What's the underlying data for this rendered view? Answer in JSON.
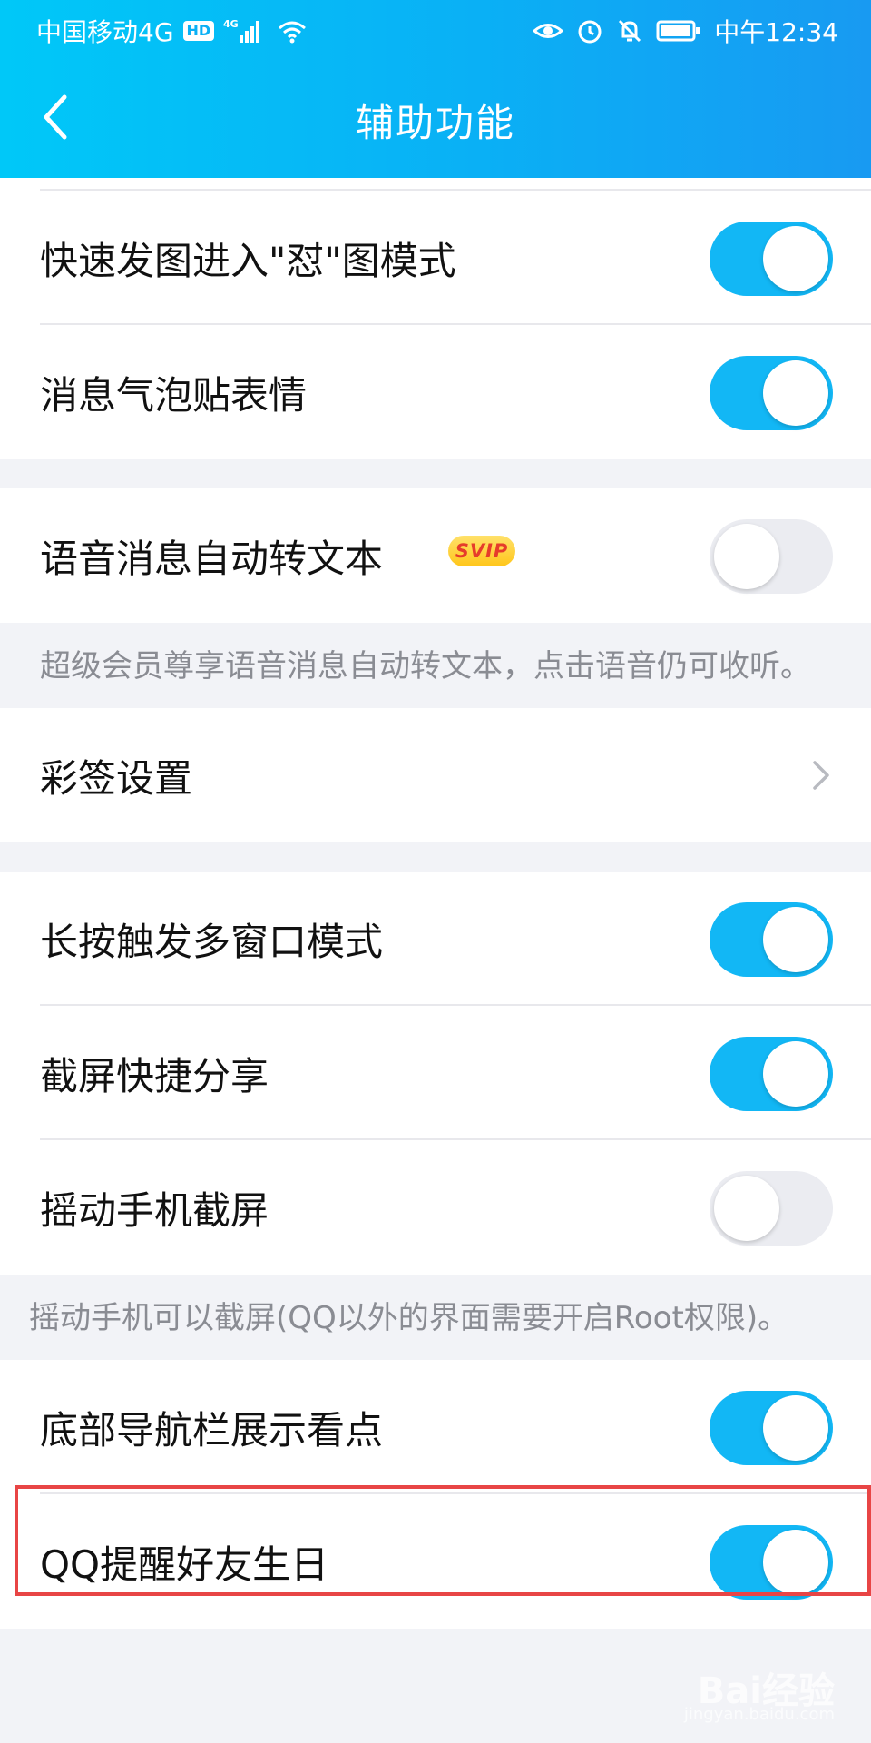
{
  "status_bar": {
    "carrier": "中国移动4G",
    "hd_badge": "HD",
    "network": "4G",
    "time": "中午12:34",
    "icons": [
      "signal-icon",
      "wifi-icon",
      "eye-icon",
      "alarm-icon",
      "mute-bell-icon",
      "battery-icon"
    ]
  },
  "nav": {
    "title": "辅助功能",
    "back_icon": "back-chevron-icon"
  },
  "groups": [
    {
      "rows": [
        {
          "label": "快速发图进入\"怼\"图模式",
          "toggle": true
        },
        {
          "label": "消息气泡贴表情",
          "toggle": true
        }
      ]
    },
    {
      "rows": [
        {
          "label": "语音消息自动转文本",
          "toggle": false,
          "badge": "SVIP"
        }
      ],
      "note": "超级会员尊享语音消息自动转文本，点击语音仍可收听。"
    },
    {
      "rows": [
        {
          "label": "彩签设置",
          "chevron": true
        }
      ]
    },
    {
      "rows": [
        {
          "label": "长按触发多窗口模式",
          "toggle": true
        },
        {
          "label": "截屏快捷分享",
          "toggle": true
        },
        {
          "label": "摇动手机截屏",
          "toggle": false
        }
      ],
      "note": "摇动手机可以截屏(QQ以外的界面需要开启Root权限)。"
    },
    {
      "rows": [
        {
          "label": "底部导航栏展示看点",
          "toggle": true,
          "highlighted": true
        },
        {
          "label": "QQ提醒好友生日",
          "toggle": true
        }
      ]
    }
  ],
  "colors": {
    "accent": "#12B7F5",
    "toggle_off": "#EBECF1",
    "highlight": "#E84545",
    "svip_bg": "#FFC61A",
    "svip_text": "#E63C2B"
  },
  "watermark": {
    "main": "Bai经验",
    "sub": "jingyan.baidu.com"
  }
}
